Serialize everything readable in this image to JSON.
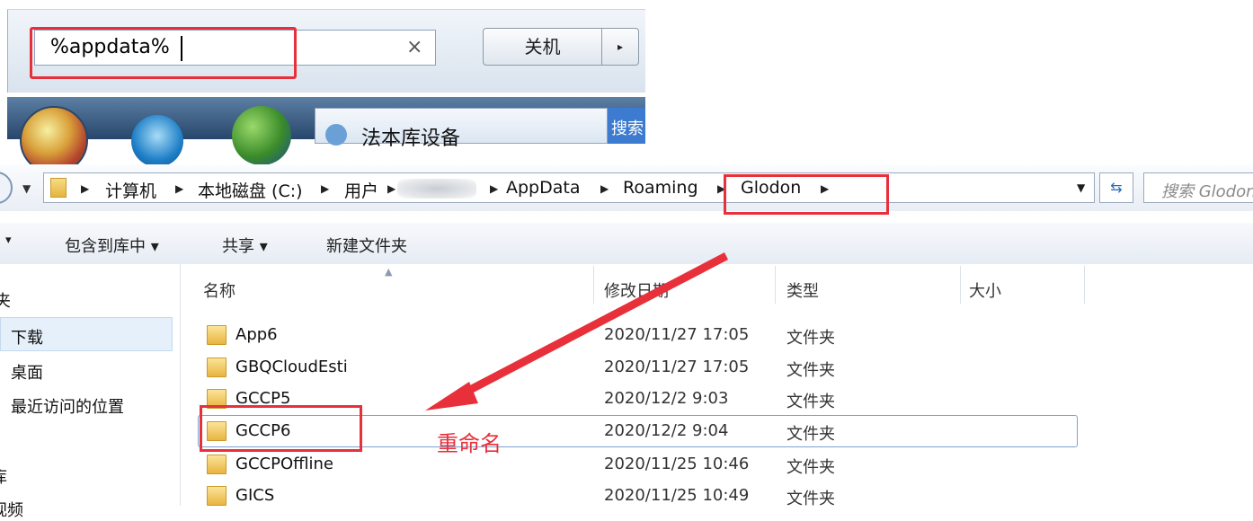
{
  "start_menu": {
    "search_value": "%appdata%",
    "clear_symbol": "×",
    "shutdown_label": "关机",
    "shutdown_arrow": "▸",
    "taskbar_item_label": "法本库设备",
    "taskbar_blue_text": "搜索"
  },
  "explorer": {
    "breadcrumb": [
      {
        "label": "计算机"
      },
      {
        "label": "本地磁盘 (C:)"
      },
      {
        "label": "用户"
      },
      {
        "label": "AppData"
      },
      {
        "label": "Roaming"
      },
      {
        "label": "Glodon"
      }
    ],
    "search_placeholder": "搜索 Glodon",
    "toolbar": {
      "menu_arrow": "▾",
      "include_in_library": "包含到库中 ▾",
      "share": "共享 ▾",
      "new_folder": "新建文件夹"
    },
    "nav_pane": [
      {
        "label": "收藏夹"
      },
      {
        "label": "下载"
      },
      {
        "label": "桌面"
      },
      {
        "label": "最近访问的位置"
      },
      {
        "label": "库"
      },
      {
        "label": "视频"
      }
    ],
    "columns": {
      "name": "名称",
      "modified": "修改日期",
      "type": "类型",
      "size": "大小"
    },
    "files": [
      {
        "name": "App6",
        "modified": "2020/11/27 17:05",
        "type": "文件夹"
      },
      {
        "name": "GBQCloudEsti",
        "modified": "2020/11/27 17:05",
        "type": "文件夹"
      },
      {
        "name": "GCCP5",
        "modified": "2020/12/2 9:03",
        "type": "文件夹"
      },
      {
        "name": "GCCP6",
        "modified": "2020/12/2 9:04",
        "type": "文件夹"
      },
      {
        "name": "GCCPOffline",
        "modified": "2020/11/25 10:46",
        "type": "文件夹"
      },
      {
        "name": "GICS",
        "modified": "2020/11/25 10:49",
        "type": "文件夹"
      }
    ]
  },
  "annotation": {
    "rename_label": "重命名",
    "highlight_color": "#e8303a"
  },
  "icons": [
    "folder-icon",
    "search-icon",
    "refresh-icon",
    "windows-orb-icon",
    "ie-icon",
    "messenger-icon"
  ]
}
